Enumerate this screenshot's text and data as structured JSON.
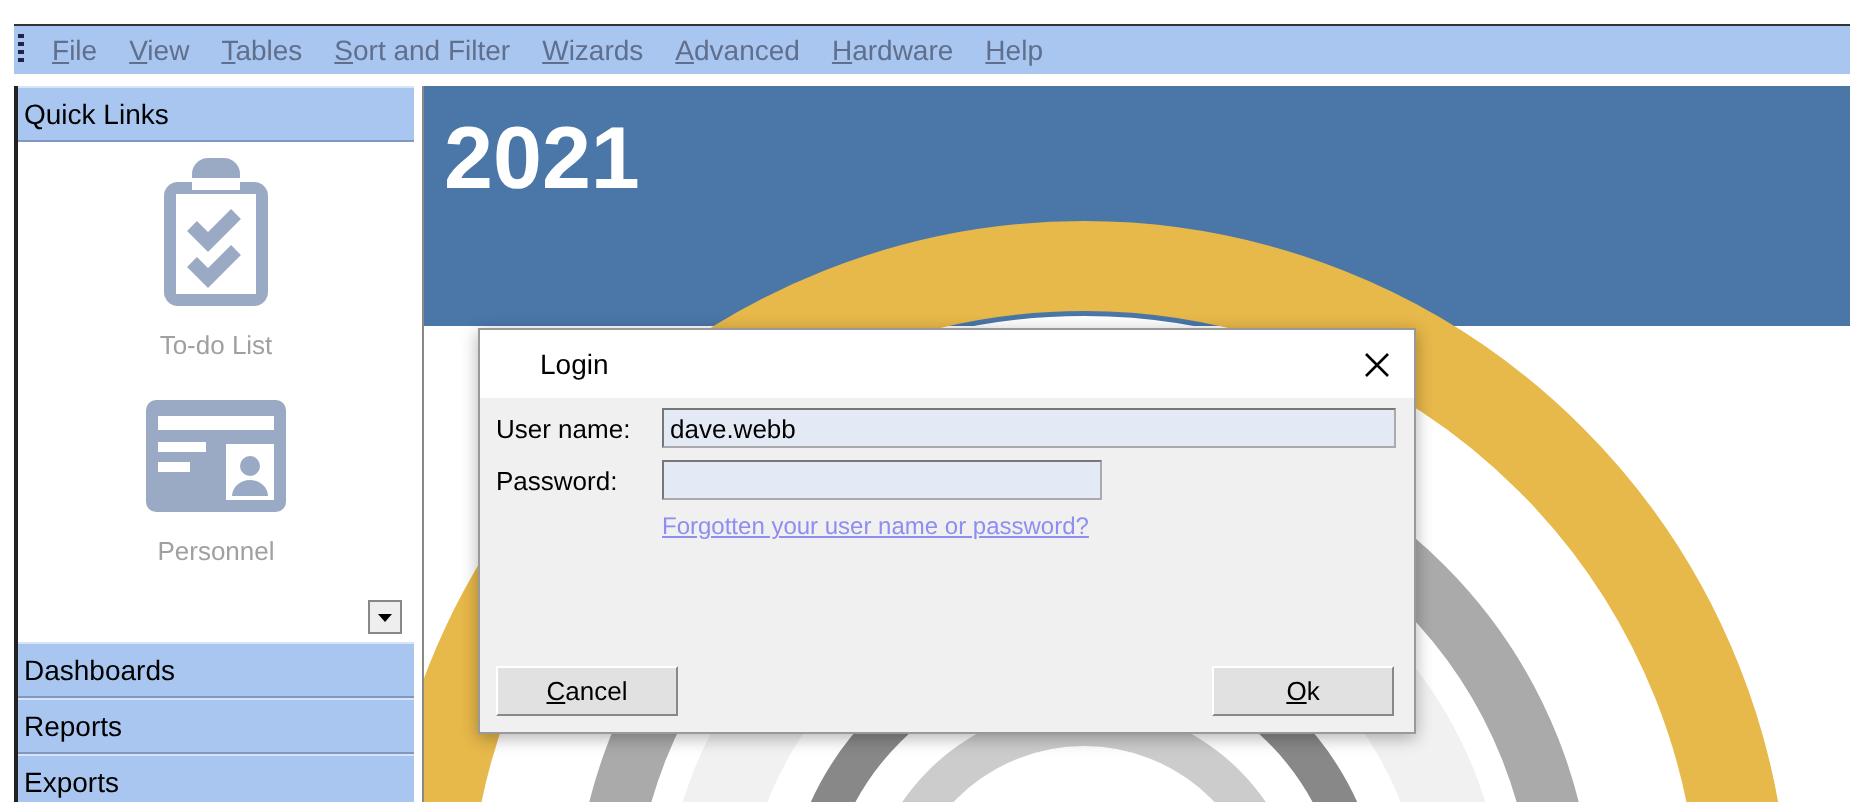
{
  "menu": [
    {
      "label": "File",
      "disabled": true
    },
    {
      "label": "View",
      "disabled": true
    },
    {
      "label": "Tables",
      "disabled": true
    },
    {
      "label": "Sort and Filter",
      "disabled": true
    },
    {
      "label": "Wizards",
      "disabled": true
    },
    {
      "label": "Advanced",
      "disabled": true
    },
    {
      "label": "Hardware",
      "disabled": true
    },
    {
      "label": "Help",
      "disabled": true
    }
  ],
  "sidebar": {
    "sections": [
      {
        "label": "Quick Links",
        "expanded": true,
        "items": [
          {
            "label": "To-do List",
            "kind": "todo"
          },
          {
            "label": "Personnel",
            "kind": "personnel"
          }
        ]
      },
      {
        "label": "Dashboards",
        "expanded": false
      },
      {
        "label": "Reports",
        "expanded": false
      },
      {
        "label": "Exports",
        "expanded": false
      }
    ]
  },
  "banner": {
    "year": "2021"
  },
  "dialog": {
    "title": "Login",
    "fields": [
      {
        "label": "User name:",
        "value": "dave.webb",
        "wide": true
      },
      {
        "label": "Password:",
        "wide": false
      }
    ],
    "link": "Forgotten your user name or password?",
    "buttons": [
      {
        "label": "Cancel"
      },
      {
        "label": "Ok"
      }
    ]
  }
}
